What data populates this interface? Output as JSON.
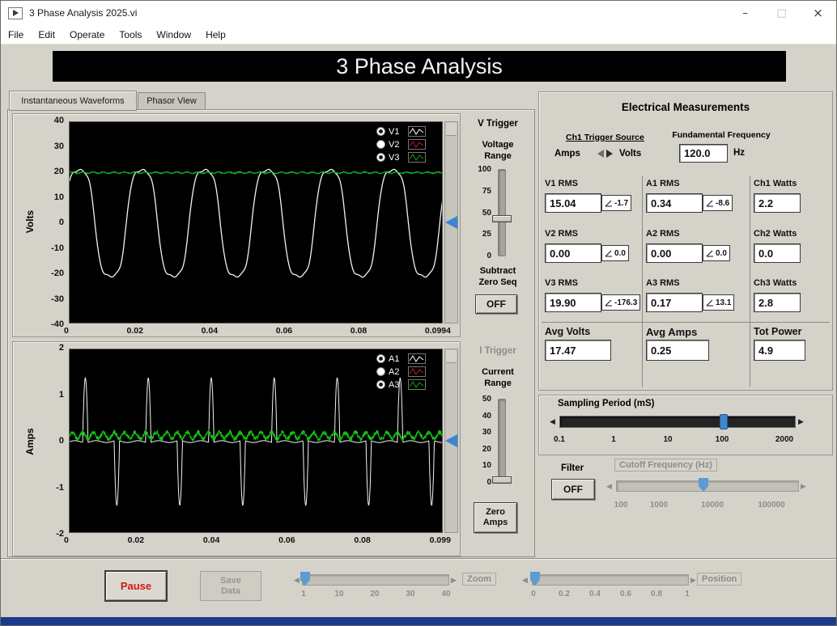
{
  "window": {
    "title": "3 Phase Analysis 2025.vi",
    "menu": [
      "File",
      "Edit",
      "Operate",
      "Tools",
      "Window",
      "Help"
    ],
    "controls": {
      "minimize": "–",
      "maximize": "□",
      "close": "×"
    }
  },
  "banner": {
    "title": "3 Phase Analysis"
  },
  "tabs": {
    "instantaneous": "Instantaneous Waveforms",
    "phasor": "Phasor View"
  },
  "charts": {
    "volts": {
      "type": "line",
      "ylabel": "Volts",
      "yticks": [
        "40",
        "30",
        "20",
        "10",
        "0",
        "-10",
        "-20",
        "-30",
        "-40"
      ],
      "xticks": [
        "0",
        "0.02",
        "0.04",
        "0.06",
        "0.08",
        "0.0994"
      ],
      "ymin": -40,
      "ymax": 40,
      "xmax": 0.0994,
      "series": [
        {
          "name": "V1",
          "color": "#f2f2f2",
          "type": "flatsine",
          "amplitude": 21,
          "frequency": 60,
          "phase": 0.6,
          "ripple": 0.35
        },
        {
          "name": "V3",
          "color": "#15c415",
          "type": "noisyflat",
          "level": 20,
          "ripple": 0.25,
          "noise": 0.15
        }
      ],
      "legend": [
        {
          "label": "V1",
          "selected": true,
          "color": "#ffffff"
        },
        {
          "label": "V2",
          "selected": false,
          "color": "#b22222"
        },
        {
          "label": "V3",
          "selected": true,
          "color": "#18a018"
        }
      ]
    },
    "amps": {
      "type": "line",
      "ylabel": "Amps",
      "yticks": [
        "2",
        "1",
        "0",
        "-1",
        "-2"
      ],
      "xticks": [
        "0",
        "0.02",
        "0.04",
        "0.06",
        "0.08",
        "0.099"
      ],
      "ymin": -2,
      "ymax": 2,
      "xmax": 0.099,
      "series": [
        {
          "name": "A1",
          "color": "#f2f2f2",
          "type": "spikes",
          "amplitude": 1.38,
          "frequency": 60
        },
        {
          "name": "A3",
          "color": "#15c415",
          "type": "noisyflat",
          "level": 0.13,
          "ripple": 0.07,
          "noise": 0.05
        }
      ],
      "legend": [
        {
          "label": "A1",
          "selected": true,
          "color": "#ffffff"
        },
        {
          "label": "A2",
          "selected": false,
          "color": "#b22222"
        },
        {
          "label": "A3",
          "selected": true,
          "color": "#18a018"
        }
      ]
    }
  },
  "v_trigger": {
    "title": "V Trigger",
    "range_label_1": "Voltage",
    "range_label_2": "Range",
    "scale": [
      "100",
      "75",
      "50",
      "25",
      "0"
    ],
    "value": 43,
    "subtract_label_1": "Subtract",
    "subtract_label_2": "Zero Seq",
    "off_button": "OFF"
  },
  "i_trigger": {
    "title": "I Trigger",
    "range_label_1": "Current",
    "range_label_2": "Range",
    "scale": [
      "50",
      "40",
      "30",
      "20",
      "10",
      "0"
    ],
    "value": 2,
    "zero_1": "Zero",
    "zero_2": "Amps"
  },
  "measurements": {
    "title": "Electrical Measurements",
    "trigger_source": {
      "label": "Ch1 Trigger Source",
      "left": "Amps",
      "right": "Volts"
    },
    "fundamental": {
      "label": "Fundamental Frequency",
      "value": "120.0",
      "unit": "Hz"
    },
    "rms": [
      {
        "label": "V1 RMS",
        "value": "15.04",
        "angle": "-1.7"
      },
      {
        "label": "V2 RMS",
        "value": "0.00",
        "angle": "0.0"
      },
      {
        "label": "V3 RMS",
        "value": "19.90",
        "angle": "-176.3"
      },
      {
        "label": "A1 RMS",
        "value": "0.34",
        "angle": "-8.6"
      },
      {
        "label": "A2 RMS",
        "value": "0.00",
        "angle": "0.0"
      },
      {
        "label": "A3 RMS",
        "value": "0.17",
        "angle": "13.1"
      }
    ],
    "watts": [
      {
        "label": "Ch1 Watts",
        "value": "2.2"
      },
      {
        "label": "Ch2 Watts",
        "value": "0.0"
      },
      {
        "label": "Ch3 Watts",
        "value": "2.8"
      }
    ],
    "avg": [
      {
        "label": "Avg Volts",
        "value": "17.47"
      },
      {
        "label": "Avg Amps",
        "value": "0.25"
      },
      {
        "label": "Tot Power",
        "value": "4.9"
      }
    ]
  },
  "sampling": {
    "label": "Sampling Period (mS)",
    "scale": [
      "0.1",
      "1",
      "10",
      "100",
      "2000"
    ],
    "value": "100"
  },
  "filter": {
    "label": "Filter",
    "off_button": "OFF",
    "cutoff_label": "Cutoff Frequency (Hz)",
    "scale": [
      "100",
      "1000",
      "10000",
      "100000"
    ]
  },
  "footer": {
    "pause": "Pause",
    "save_1": "Save",
    "save_2": "Data",
    "zoom_label": "Zoom",
    "zoom_scale": [
      "1",
      "10",
      "20",
      "30",
      "40"
    ],
    "position_label": "Position",
    "position_scale": [
      "0",
      "0.2",
      "0.4",
      "0.6",
      "0.8",
      "1"
    ]
  }
}
